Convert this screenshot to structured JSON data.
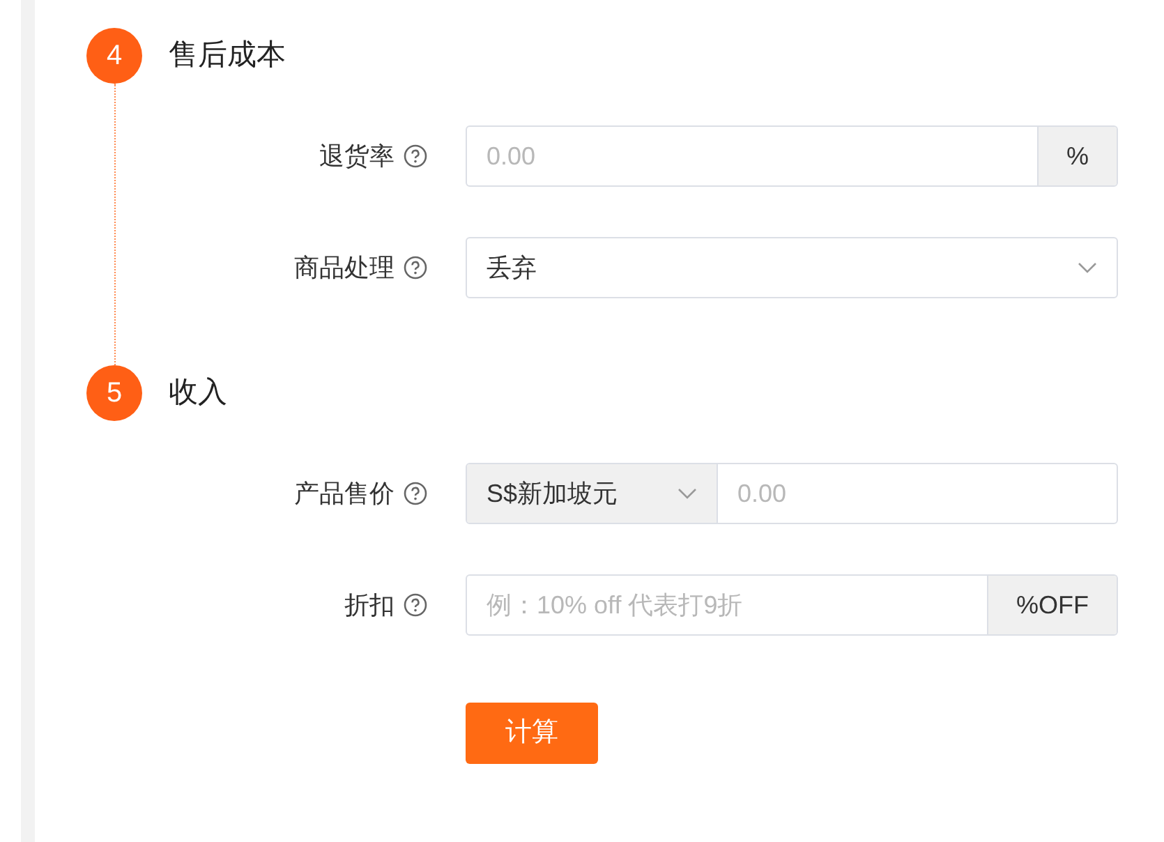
{
  "sections": [
    {
      "number": "4",
      "title": "售后成本",
      "fields": [
        {
          "kind": "input-suffix",
          "label": "退货率",
          "placeholder": "0.00",
          "suffix": "%"
        },
        {
          "kind": "select",
          "label": "商品处理",
          "value": "丢弃"
        }
      ]
    },
    {
      "number": "5",
      "title": "收入",
      "fields": [
        {
          "kind": "currency",
          "label": "产品售价",
          "currency": "S$新加坡元",
          "placeholder": "0.00"
        },
        {
          "kind": "input-suffix",
          "label": "折扣",
          "placeholder": "例：10% off 代表打9折",
          "suffix": "%OFF"
        }
      ]
    }
  ],
  "button": "计算"
}
